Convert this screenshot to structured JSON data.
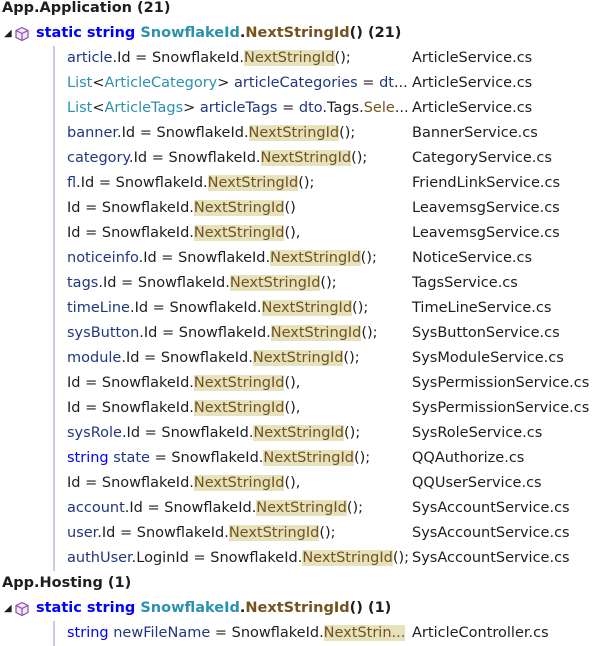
{
  "groups": [
    {
      "label": "App.Application",
      "count": "(21)",
      "method": {
        "static": "static",
        "type": "string",
        "class": "SnowflakeId",
        "dot": ".",
        "name": "NextStringId",
        "parens": "()",
        "count": "(21)"
      },
      "refs": [
        {
          "pre": "article.Id = SnowflakeId.",
          "hl": "NextStringId",
          "post": "();",
          "file": "ArticleService.cs"
        },
        {
          "pre": "List<ArticleCategory> articleCategories = dt...",
          "hl": "",
          "post": "",
          "file": "ArticleService.cs"
        },
        {
          "pre": "List<ArticleTags> articleTags = dto.Tags.Sele...",
          "hl": "",
          "post": "",
          "file": "ArticleService.cs"
        },
        {
          "pre": "banner.Id = SnowflakeId.",
          "hl": "NextStringId",
          "post": "();",
          "file": "BannerService.cs"
        },
        {
          "pre": "category.Id = SnowflakeId.",
          "hl": "NextStringId",
          "post": "();",
          "file": "CategoryService.cs"
        },
        {
          "pre": "fl.Id = SnowflakeId.",
          "hl": "NextStringId",
          "post": "();",
          "file": "FriendLinkService.cs"
        },
        {
          "pre": "Id = SnowflakeId.",
          "hl": "NextStringId",
          "post": "()",
          "file": "LeavemsgService.cs"
        },
        {
          "pre": "Id = SnowflakeId.",
          "hl": "NextStringId",
          "post": "(),",
          "file": "LeavemsgService.cs"
        },
        {
          "pre": "noticeinfo.Id = SnowflakeId.",
          "hl": "NextStringId",
          "post": "();",
          "file": "NoticeService.cs"
        },
        {
          "pre": "tags.Id = SnowflakeId.",
          "hl": "NextStringId",
          "post": "();",
          "file": "TagsService.cs"
        },
        {
          "pre": "timeLine.Id = SnowflakeId.",
          "hl": "NextStringId",
          "post": "();",
          "file": "TimeLineService.cs"
        },
        {
          "pre": "sysButton.Id = SnowflakeId.",
          "hl": "NextStringId",
          "post": "();",
          "file": "SysButtonService.cs"
        },
        {
          "pre": "module.Id = SnowflakeId.",
          "hl": "NextStringId",
          "post": "();",
          "file": "SysModuleService.cs"
        },
        {
          "pre": "Id = SnowflakeId.",
          "hl": "NextStringId",
          "post": "(),",
          "file": "SysPermissionService.cs"
        },
        {
          "pre": "Id = SnowflakeId.",
          "hl": "NextStringId",
          "post": "(),",
          "file": "SysPermissionService.cs"
        },
        {
          "pre": "sysRole.Id = SnowflakeId.",
          "hl": "NextStringId",
          "post": "();",
          "file": "SysRoleService.cs"
        },
        {
          "pre": "string state = SnowflakeId.",
          "hl": "NextStringId",
          "post": "();",
          "file": "QQAuthorize.cs"
        },
        {
          "pre": "Id = SnowflakeId.",
          "hl": "NextStringId",
          "post": "(),",
          "file": "QQUserService.cs"
        },
        {
          "pre": "account.Id = SnowflakeId.",
          "hl": "NextStringId",
          "post": "();",
          "file": "SysAccountService.cs"
        },
        {
          "pre": "user.Id = SnowflakeId.",
          "hl": "NextStringId",
          "post": "();",
          "file": "SysAccountService.cs"
        },
        {
          "pre": "authUser.LoginId = SnowflakeId.",
          "hl": "NextStringId",
          "post": "();",
          "file": "SysAccountService.cs"
        }
      ]
    },
    {
      "label": "App.Hosting",
      "count": "(1)",
      "method": {
        "static": "static",
        "type": "string",
        "class": "SnowflakeId",
        "dot": ".",
        "name": "NextStringId",
        "parens": "()",
        "count": "(1)"
      },
      "refs": [
        {
          "pre": "string newFileName = SnowflakeId.",
          "hl": "NextStrin...",
          "post": "",
          "file": "ArticleController.cs"
        }
      ]
    }
  ]
}
